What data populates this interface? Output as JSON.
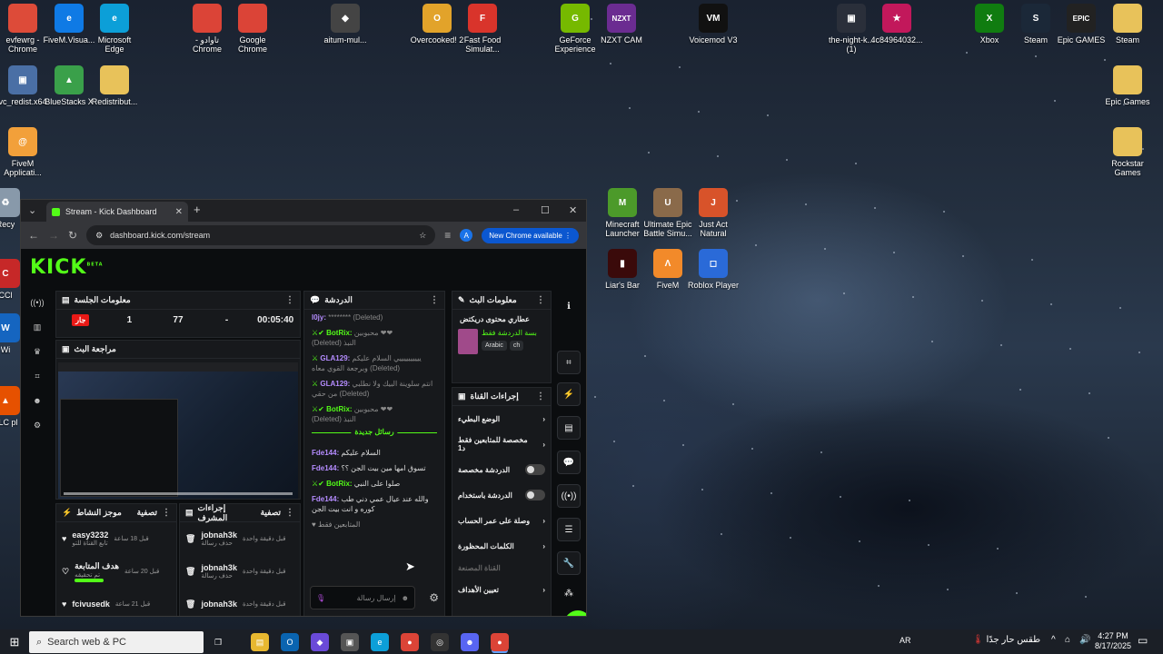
{
  "desktop": {
    "icons": [
      {
        "label": "evfewrg - Chrome",
        "color": "#dd4b39",
        "glyph": "●"
      },
      {
        "label": "FiveM.Visua...",
        "color": "#0f7ae5",
        "glyph": "e"
      },
      {
        "label": "Microsoft Edge",
        "color": "#0c9fd8",
        "glyph": "e"
      },
      {
        "label": "- تاوادو Chrome",
        "color": "#db4437",
        "glyph": "●"
      },
      {
        "label": "Google Chrome",
        "color": "#db4437",
        "glyph": "●"
      },
      {
        "label": "aitum-mul...",
        "color": "#444",
        "glyph": "◆"
      },
      {
        "label": "Overcooked! 2",
        "color": "#e2a32a",
        "glyph": "O"
      },
      {
        "label": "Fast Food Simulat...",
        "color": "#d9342b",
        "glyph": "F"
      },
      {
        "label": "GeForce Experience",
        "color": "#76b900",
        "glyph": "G"
      },
      {
        "label": "NZXT CAM",
        "color": "#6b2c91",
        "glyph": "NZXT"
      },
      {
        "label": "Voicemod V3",
        "color": "#111",
        "glyph": "VM"
      },
      {
        "label": "the-night-k... (1)",
        "color": "#2a2f3a",
        "glyph": "▣"
      },
      {
        "label": "4c84964032...",
        "color": "#c2185b",
        "glyph": "★"
      },
      {
        "label": "Xbox",
        "color": "#107c10",
        "glyph": "X"
      },
      {
        "label": "Steam",
        "color": "#1b2838",
        "glyph": "S"
      },
      {
        "label": "Epic GAMES",
        "color": "#222",
        "glyph": "EPIC"
      },
      {
        "label": "Steam",
        "color": "#e8c25a",
        "glyph": "▤"
      },
      {
        "label": "vc_redist.x64",
        "color": "#4a6fa5",
        "glyph": "▣"
      },
      {
        "label": "BlueStacks X",
        "color": "#3aa04a",
        "glyph": "▲"
      },
      {
        "label": "Redistribut...",
        "color": "#e8c25a",
        "glyph": "▤"
      },
      {
        "label": "Epic Games",
        "color": "#e8c25a",
        "glyph": "▤"
      },
      {
        "label": "FiveM Applicati...",
        "color": "#f2a03a",
        "glyph": "@"
      },
      {
        "label": "Rockstar Games",
        "color": "#e8c25a",
        "glyph": "▤"
      },
      {
        "label": "Minecraft Launcher",
        "color": "#4c9a2a",
        "glyph": "M"
      },
      {
        "label": "Ultimate Epic Battle Simu...",
        "color": "#8a6a4a",
        "glyph": "U"
      },
      {
        "label": "Just Act Natural",
        "color": "#d8532a",
        "glyph": "J"
      },
      {
        "label": "Liar's Bar",
        "color": "#3a0a0a",
        "glyph": "▮"
      },
      {
        "label": "FiveM",
        "color": "#f28a2a",
        "glyph": "Λ"
      },
      {
        "label": "Roblox Player",
        "color": "#2a6ad8",
        "glyph": "◻"
      },
      {
        "label": "Recy",
        "color": "#8899aa",
        "glyph": "♻"
      },
      {
        "label": "CCl",
        "color": "#c62828",
        "glyph": "C"
      },
      {
        "label": "Wi",
        "color": "#1565c0",
        "glyph": "W"
      },
      {
        "label": "VLC pl",
        "color": "#e65100",
        "glyph": "▲"
      }
    ]
  },
  "browser": {
    "tab_title": "Stream - Kick Dashboard",
    "url": "dashboard.kick.com/stream",
    "new_chrome": "New Chrome available",
    "avatar_letter": "A"
  },
  "kick": {
    "logo": "KICK",
    "beta": "BETA",
    "session": {
      "title": "معلومات الجلسة",
      "live": "جار",
      "viewers": "1",
      "followers": "77",
      "subs": "-",
      "time": "00:05:40"
    },
    "preview_title": "مراجعة البث",
    "chat": {
      "title": "الدردشة",
      "messages": [
        {
          "user": "l0jy:",
          "text": "********",
          "extra": "(Deleted)",
          "color": "#b58cff"
        },
        {
          "user": "BotRix:",
          "text": "محبوبين ❤❤",
          "extra": "(Deleted) النبذ",
          "color": "#53fc18"
        },
        {
          "user": "GLA129:",
          "text": "ييييييييييي السلام عليكم وبرجعة القوي معاه",
          "extra": "(Deleted)",
          "color": "#b58cff"
        },
        {
          "user": "GLA129:",
          "text": "انتم سلوينة البيك ولا نطلبي من حقي",
          "extra": "(Deleted)",
          "color": "#b58cff"
        },
        {
          "user": "BotRix:",
          "text": "محبوبين ❤❤",
          "extra": "(Deleted) النبذ",
          "color": "#53fc18"
        }
      ],
      "separator": "رسائل جديدة",
      "new_messages": [
        {
          "user": "Fde144:",
          "text": "السلام عليكم",
          "color": "#b58cff"
        },
        {
          "user": "Fde144:",
          "text": "تسوق امها مين بيت الجن ؟؟",
          "color": "#b58cff"
        },
        {
          "user": "BotRix:",
          "text": "صلوا على النبي",
          "color": "#53fc18"
        },
        {
          "user": "Fde144:",
          "text": "والله عند عيال عمي دني طب كوره و انت بيت الجن",
          "color": "#b58cff"
        }
      ],
      "followers_only": "المتابعين فقط",
      "input_placeholder": "إرسال رسالة"
    },
    "stream_info": {
      "title": "معلومات البث",
      "name": "عطاري محتوى دريكتض",
      "subtitle": "بسة الدردشة فقط",
      "tags": [
        "Arabic",
        "ch"
      ]
    },
    "channel_actions": {
      "title": "إجراءات القناة",
      "items": [
        {
          "label": "الوضع البطيء",
          "type": "arrow"
        },
        {
          "label": "مخصصة للمتابعين فقط د1",
          "type": "arrow"
        },
        {
          "label": "الدردشة مخصصة",
          "type": "toggle"
        },
        {
          "label": "الدردشة باستخدام",
          "type": "toggle"
        },
        {
          "label": "وصلة على عمر الحساب",
          "type": "arrow"
        },
        {
          "label": "الكلمات المحظورة",
          "type": "arrow"
        },
        {
          "label": "القناة المصنعة",
          "type": "muted"
        },
        {
          "label": "تعيين الأهداف",
          "type": "arrow"
        }
      ]
    },
    "activity": {
      "title": "موجز النشاط",
      "filter": "تصفية",
      "items": [
        {
          "user": "easy3232",
          "time": "قبل 18 ساعة",
          "desc": "تابع القناة للتو",
          "icon": "heart"
        },
        {
          "user": "هدف المتابعة",
          "time": "قبل 20 ساعة",
          "desc": "تم تحقيقه",
          "icon": "heart-outline"
        },
        {
          "user": "fcivusedk",
          "time": "قبل 21 ساعة",
          "desc": "",
          "icon": "heart"
        }
      ]
    },
    "mod_actions": {
      "title": "إجراءات المشرف",
      "filter": "تصفية",
      "items": [
        {
          "user": "jobnah3k",
          "time": "قبل دقيقة واحدة",
          "desc": "حذف رسالة"
        },
        {
          "user": "jobnah3k",
          "time": "قبل دقيقة واحدة",
          "desc": "حذف رسالة"
        },
        {
          "user": "jobnah3k",
          "time": "قبل دقيقة واحدة",
          "desc": ""
        }
      ]
    }
  },
  "taskbar": {
    "search_placeholder": "Search web & PC",
    "lang": "AR",
    "weather": "طقس حار جدًا",
    "time": "4:27 PM",
    "date": "8/17/2025"
  }
}
